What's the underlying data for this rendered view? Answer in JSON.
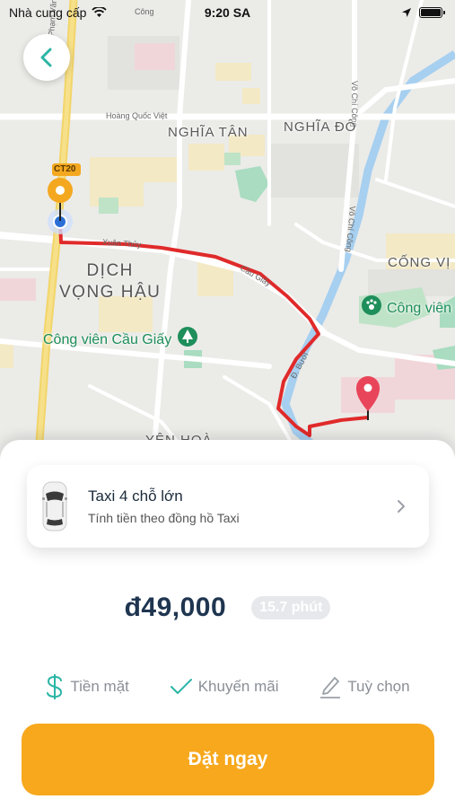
{
  "status_bar": {
    "carrier": "Nhà cung cấp",
    "time": "9:20 SA",
    "battery_level": 1.0
  },
  "map": {
    "districts": {
      "nghia_tan": "NGHĨA TÂN",
      "nghia_do": "NGHĨA ĐÔ",
      "cong_vi": "CỐNG VỊ",
      "dich_vong_hau": "DỊCH\nVỌNG HẬU",
      "yen_hoa": "YÊN HOÀ"
    },
    "parks": {
      "cau_giay": "Công viên Cầu Giấy",
      "cong_vien": "Công viên"
    },
    "roads": {
      "hoang_quoc_viet": "Hoàng Quốc Việt",
      "xuan_thuy": "Xuân Thủy",
      "cau_giay": "Cầu Giấy",
      "pham_van_dong": "Phạm Văn Đồng",
      "vo_chi_cong": "Võ Chí Công",
      "buoi": "Đ. Bưởi",
      "ct20": "CT20",
      "cong_short": "Công",
      "vo_chi_cong_2": "Võ Chí Công"
    },
    "route_color": "#e02a2a",
    "pickup_color": "#f4a820",
    "current_location_color": "#2b6fd6",
    "destination_color": "#e8455a"
  },
  "back_button": {
    "icon": "chevron-left-icon",
    "color": "#2bb5a5"
  },
  "vehicle": {
    "name": "Taxi 4 chỗ lớn",
    "description": "Tính tiền theo đồng hồ Taxi"
  },
  "fare": {
    "price": "đ49,000",
    "duration": "15.7 phút"
  },
  "options": {
    "payment": {
      "label": "Tiền mặt",
      "icon": "dollar-icon",
      "color": "#2bb5a5"
    },
    "promo": {
      "label": "Khuyến mãi",
      "icon": "check-icon",
      "color": "#2bb5a5"
    },
    "settings": {
      "label": "Tuỳ chọn",
      "icon": "pencil-icon",
      "color": "#9aa0a6"
    }
  },
  "book_button": {
    "label": "Đặt ngay",
    "color": "#f7a81d"
  }
}
